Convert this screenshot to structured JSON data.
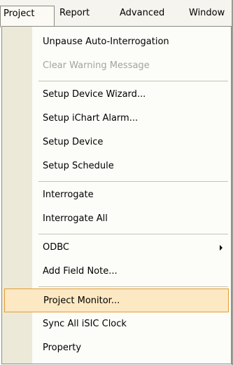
{
  "menubar": {
    "items": [
      {
        "label": "Project",
        "open": true
      },
      {
        "label": "Report"
      },
      {
        "label": "Advanced"
      },
      {
        "label": "Window"
      }
    ]
  },
  "dropdown": {
    "items": [
      {
        "label": "Unpause Auto-Interrogation"
      },
      {
        "label": "Clear Warning Message",
        "disabled": true
      },
      {
        "label": "Setup Device Wizard..."
      },
      {
        "label": "Setup iChart Alarm..."
      },
      {
        "label": "Setup Device"
      },
      {
        "label": "Setup Schedule"
      },
      {
        "label": "Interrogate"
      },
      {
        "label": "Interrogate All"
      },
      {
        "label": "ODBC",
        "has_submenu": true
      },
      {
        "label": "Add Field Note..."
      },
      {
        "label": "Project Monitor...",
        "highlighted": true
      },
      {
        "label": "Sync All iSIC Clock"
      },
      {
        "label": "Property"
      }
    ]
  },
  "colors": {
    "highlight_fill": "#fce8c2",
    "highlight_border": "#e39c31",
    "disabled_text": "#a4a39b",
    "gutter": "#ece9d8"
  }
}
